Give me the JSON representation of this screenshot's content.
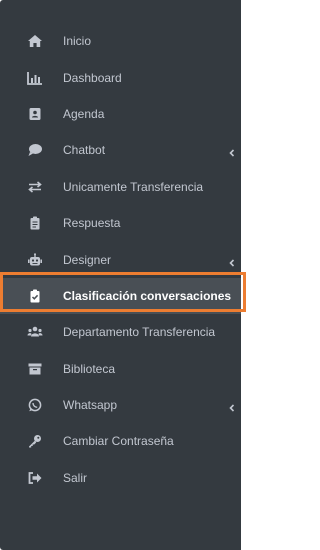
{
  "sidebar": {
    "items": [
      {
        "label": "Inicio",
        "icon": "home-icon",
        "has_submenu": false
      },
      {
        "label": "Dashboard",
        "icon": "chart-bar-icon",
        "has_submenu": false
      },
      {
        "label": "Agenda",
        "icon": "address-book-icon",
        "has_submenu": false
      },
      {
        "label": "Chatbot",
        "icon": "comment-icon",
        "has_submenu": true
      },
      {
        "label": "Unicamente Transferencia",
        "icon": "exchange-icon",
        "has_submenu": false
      },
      {
        "label": "Respuesta",
        "icon": "clipboard-icon",
        "has_submenu": false
      },
      {
        "label": "Designer",
        "icon": "robot-icon",
        "has_submenu": true
      },
      {
        "label": "Clasificación conversaciones",
        "icon": "clipboard-check-icon",
        "has_submenu": false,
        "active": true
      },
      {
        "label": "Departamento Transferencia",
        "icon": "users-icon",
        "has_submenu": false
      },
      {
        "label": "Biblioteca",
        "icon": "archive-icon",
        "has_submenu": false
      },
      {
        "label": "Whatsapp",
        "icon": "whatsapp-icon",
        "has_submenu": true
      },
      {
        "label": "Cambiar Contraseña",
        "icon": "key-icon",
        "has_submenu": false
      },
      {
        "label": "Salir",
        "icon": "sign-out-icon",
        "has_submenu": false
      }
    ]
  },
  "colors": {
    "sidebar_bg": "#343a40",
    "text": "#c2c7d0",
    "active_bg": "#494f55",
    "highlight_border": "#ed7d31"
  }
}
